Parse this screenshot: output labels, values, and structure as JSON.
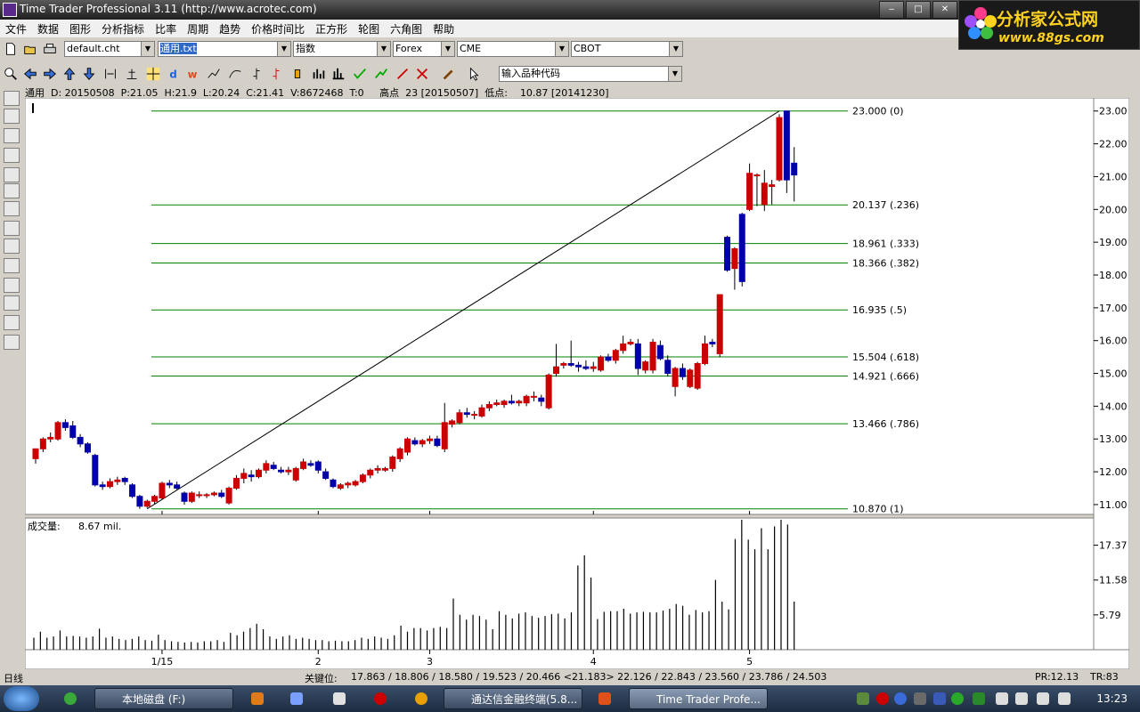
{
  "window": {
    "title": "Time Trader Professional 3.11 (http://www.acrotec.com)"
  },
  "logo": {
    "main": "分析家公式网",
    "url": "www.88gs.com"
  },
  "menu": [
    "文件",
    "数据",
    "图形",
    "分析指标",
    "比率",
    "周期",
    "趋势",
    "价格时间比",
    "正方形",
    "轮图",
    "六角图",
    "帮助"
  ],
  "toolbar": {
    "chart_file": "default.cht",
    "data_file": "通用.txt",
    "index_label": "指数",
    "market1": "Forex",
    "market2": "CME",
    "market3": "CBOT",
    "symbol_input": "输入品种代码"
  },
  "infobar": {
    "text": "通用  D: 20150508  P:21.05  H:21.9  L:20.24  C:21.41  V:8672468  T:0",
    "high_label": "高点",
    "high_text": "23 [20150507]",
    "low_label": "低点:",
    "low_text": "10.87 [20141230]"
  },
  "volume_panel": {
    "label": "成交量:",
    "value": "8.67 mil."
  },
  "statusbar": {
    "period": "日线",
    "key_label": "关键位:",
    "key_values": "17.863 / 18.806 / 18.580 / 19.523 / 20.466 <21.183> 22.126 / 22.843 / 23.560 / 23.786 / 24.503",
    "pr": "PR:12.13",
    "tr": "TR:83"
  },
  "taskbar": {
    "items": [
      "本地磁盘 (F:)",
      "通达信金融终端(5.8...",
      "Time Trader Profe..."
    ],
    "clock": "13:23"
  },
  "colors": {
    "up": "#cc0000",
    "down": "#0000aa",
    "fib": "#008000",
    "bg": "#ffffff"
  },
  "chart_data": [
    {
      "type": "candlestick",
      "x_tick_labels": [
        "1/15",
        "2",
        "3",
        "4",
        "5"
      ],
      "x_tick_index": [
        17,
        38,
        53,
        75,
        96
      ],
      "y_ticks": [
        "11.00",
        "12.00",
        "13.00",
        "14.00",
        "15.00",
        "16.00",
        "17.00",
        "18.00",
        "19.00",
        "20.00",
        "21.00",
        "22.00",
        "23.00"
      ],
      "ylim": [
        10.7,
        23.4
      ],
      "fib_levels": [
        {
          "price": 23.0,
          "label": "23.000",
          "ratio": "(0)"
        },
        {
          "price": 20.137,
          "label": "20.137",
          "ratio": "(.236)"
        },
        {
          "price": 18.961,
          "label": "18.961",
          "ratio": "(.333)"
        },
        {
          "price": 18.366,
          "label": "18.366",
          "ratio": "(.382)"
        },
        {
          "price": 16.935,
          "label": "16.935",
          "ratio": "(.5)"
        },
        {
          "price": 15.504,
          "label": "15.504",
          "ratio": "(.618)"
        },
        {
          "price": 14.921,
          "label": "14.921",
          "ratio": "(.666)"
        },
        {
          "price": 13.466,
          "label": "13.466",
          "ratio": "(.786)"
        },
        {
          "price": 10.87,
          "label": "10.870",
          "ratio": "(1)"
        }
      ],
      "trendline": {
        "from": {
          "index": 15,
          "price": 10.87
        },
        "to": {
          "index": 100,
          "price": 23.0
        }
      },
      "ohlc": [
        [
          12.4,
          12.7,
          12.25,
          12.7
        ],
        [
          12.7,
          13.05,
          12.6,
          13.0
        ],
        [
          13.0,
          13.2,
          12.9,
          13.05
        ],
        [
          13.0,
          13.55,
          12.95,
          13.5
        ],
        [
          13.5,
          13.6,
          13.25,
          13.35
        ],
        [
          13.4,
          13.55,
          13.0,
          13.05
        ],
        [
          13.05,
          13.15,
          12.75,
          12.85
        ],
        [
          12.85,
          12.9,
          12.55,
          12.6
        ],
        [
          12.5,
          12.55,
          11.55,
          11.6
        ],
        [
          11.6,
          11.7,
          11.45,
          11.55
        ],
        [
          11.55,
          11.8,
          11.5,
          11.7
        ],
        [
          11.7,
          11.85,
          11.6,
          11.75
        ],
        [
          11.8,
          11.85,
          11.6,
          11.7
        ],
        [
          11.6,
          11.65,
          11.2,
          11.25
        ],
        [
          11.25,
          11.3,
          10.87,
          10.95
        ],
        [
          10.95,
          11.15,
          10.9,
          11.1
        ],
        [
          11.1,
          11.3,
          11.0,
          11.25
        ],
        [
          11.2,
          11.7,
          11.15,
          11.65
        ],
        [
          11.65,
          11.75,
          11.5,
          11.6
        ],
        [
          11.6,
          11.7,
          11.45,
          11.5
        ],
        [
          11.35,
          11.4,
          11.0,
          11.1
        ],
        [
          11.1,
          11.4,
          11.05,
          11.35
        ],
        [
          11.3,
          11.4,
          11.2,
          11.3
        ],
        [
          11.3,
          11.35,
          11.2,
          11.3
        ],
        [
          11.3,
          11.4,
          11.25,
          11.35
        ],
        [
          11.35,
          11.45,
          11.2,
          11.25
        ],
        [
          11.05,
          11.55,
          11.0,
          11.5
        ],
        [
          11.5,
          11.9,
          11.45,
          11.8
        ],
        [
          11.8,
          12.1,
          11.65,
          11.95
        ],
        [
          11.9,
          12.05,
          11.7,
          11.85
        ],
        [
          11.85,
          12.1,
          11.8,
          12.05
        ],
        [
          12.05,
          12.35,
          11.95,
          12.25
        ],
        [
          12.2,
          12.3,
          12.05,
          12.1
        ],
        [
          12.05,
          12.15,
          11.95,
          12.0
        ],
        [
          12.0,
          12.15,
          11.9,
          12.05
        ],
        [
          11.75,
          12.15,
          11.7,
          12.1
        ],
        [
          12.1,
          12.4,
          12.05,
          12.3
        ],
        [
          12.25,
          12.35,
          12.15,
          12.2
        ],
        [
          12.3,
          12.35,
          11.95,
          12.05
        ],
        [
          12.0,
          12.1,
          11.75,
          11.8
        ],
        [
          11.75,
          11.8,
          11.5,
          11.55
        ],
        [
          11.5,
          11.65,
          11.45,
          11.6
        ],
        [
          11.6,
          11.7,
          11.5,
          11.65
        ],
        [
          11.6,
          11.75,
          11.55,
          11.7
        ],
        [
          11.7,
          11.95,
          11.65,
          11.9
        ],
        [
          11.9,
          12.1,
          11.8,
          12.05
        ],
        [
          12.05,
          12.2,
          11.95,
          12.1
        ],
        [
          12.05,
          12.15,
          12.0,
          12.1
        ],
        [
          12.1,
          12.5,
          12.0,
          12.45
        ],
        [
          12.4,
          12.75,
          12.3,
          12.7
        ],
        [
          12.6,
          13.05,
          12.5,
          13.0
        ],
        [
          12.95,
          13.05,
          12.8,
          12.85
        ],
        [
          12.85,
          13.0,
          12.75,
          12.95
        ],
        [
          12.95,
          13.1,
          12.85,
          13.0
        ],
        [
          13.0,
          13.1,
          12.75,
          12.8
        ],
        [
          12.7,
          14.1,
          12.6,
          13.5
        ],
        [
          13.45,
          13.6,
          13.35,
          13.55
        ],
        [
          13.5,
          13.9,
          13.45,
          13.8
        ],
        [
          13.8,
          13.95,
          13.65,
          13.75
        ],
        [
          13.75,
          13.85,
          13.6,
          13.75
        ],
        [
          13.7,
          14.05,
          13.65,
          13.95
        ],
        [
          13.95,
          14.15,
          13.85,
          14.05
        ],
        [
          14.05,
          14.2,
          14.0,
          14.1
        ],
        [
          14.05,
          14.2,
          13.95,
          14.15
        ],
        [
          14.15,
          14.35,
          14.05,
          14.1
        ],
        [
          14.1,
          14.2,
          14.0,
          14.15
        ],
        [
          14.1,
          14.35,
          14.0,
          14.3
        ],
        [
          14.3,
          14.45,
          14.15,
          14.3
        ],
        [
          14.25,
          14.35,
          14.0,
          14.15
        ],
        [
          13.95,
          15.0,
          13.9,
          14.95
        ],
        [
          15.0,
          15.9,
          14.9,
          15.2
        ],
        [
          15.25,
          15.35,
          15.15,
          15.3
        ],
        [
          15.3,
          16.0,
          15.2,
          15.25
        ],
        [
          15.25,
          15.35,
          15.05,
          15.2
        ],
        [
          15.2,
          15.4,
          15.1,
          15.15
        ],
        [
          15.15,
          15.35,
          15.05,
          15.2
        ],
        [
          15.1,
          15.55,
          15.05,
          15.5
        ],
        [
          15.5,
          15.6,
          15.35,
          15.4
        ],
        [
          15.4,
          15.75,
          15.3,
          15.7
        ],
        [
          15.7,
          16.15,
          15.6,
          15.9
        ],
        [
          15.9,
          16.05,
          15.85,
          15.95
        ],
        [
          15.9,
          16.05,
          14.95,
          15.15
        ],
        [
          15.1,
          15.4,
          15.0,
          15.35
        ],
        [
          15.1,
          16.05,
          15.0,
          15.95
        ],
        [
          15.85,
          16.0,
          15.4,
          15.45
        ],
        [
          15.4,
          15.55,
          14.9,
          15.0
        ],
        [
          14.6,
          15.2,
          14.3,
          15.15
        ],
        [
          15.15,
          15.3,
          14.8,
          14.9
        ],
        [
          14.6,
          15.15,
          14.55,
          15.1
        ],
        [
          14.55,
          15.35,
          14.5,
          15.3
        ],
        [
          15.3,
          16.15,
          15.25,
          15.9
        ],
        [
          15.95,
          16.05,
          15.8,
          15.9
        ],
        [
          15.6,
          17.4,
          15.5,
          17.4
        ],
        [
          19.15,
          19.2,
          18.1,
          18.15
        ],
        [
          18.2,
          18.85,
          17.55,
          18.8
        ],
        [
          19.85,
          19.9,
          17.65,
          17.8
        ],
        [
          20.0,
          21.4,
          19.95,
          21.1
        ],
        [
          21.05,
          21.1,
          20.1,
          21.05
        ],
        [
          20.15,
          21.2,
          19.95,
          20.8
        ],
        [
          20.7,
          20.9,
          20.15,
          20.75
        ],
        [
          20.9,
          22.9,
          20.85,
          22.8
        ],
        [
          23.0,
          23.0,
          20.5,
          20.9
        ],
        [
          21.41,
          21.9,
          20.24,
          21.05
        ]
      ]
    },
    {
      "type": "bar",
      "name": "成交量",
      "y_ticks": [
        "5.79",
        "11.58",
        "17.37"
      ],
      "ylim": [
        0,
        21.9
      ],
      "values": [
        2.0,
        3.0,
        2.0,
        2.2,
        3.2,
        2.2,
        2.3,
        2.2,
        2.0,
        2.2,
        3.5,
        2.0,
        2.2,
        1.8,
        1.6,
        1.8,
        2.2,
        1.6,
        1.5,
        2.5,
        1.6,
        1.4,
        1.3,
        1.2,
        1.3,
        1.2,
        1.4,
        1.4,
        1.6,
        1.3,
        2.8,
        2.4,
        3.0,
        3.6,
        4.3,
        3.4,
        2.2,
        1.8,
        2.2,
        2.4,
        1.8,
        2.0,
        1.8,
        1.6,
        1.6,
        1.4,
        1.5,
        1.4,
        1.4,
        1.6,
        2.0,
        1.8,
        2.2,
        2.0,
        1.8,
        2.4,
        4.0,
        3.0,
        3.6,
        3.6,
        3.2,
        3.6,
        3.8,
        3.6,
        8.5,
        5.8,
        5.0,
        5.8,
        5.6,
        5.0,
        3.4,
        6.4,
        5.8,
        5.2,
        6.0,
        6.2,
        5.6,
        5.3,
        5.6,
        5.9,
        6.0,
        5.2,
        6.2,
        14.0,
        15.7,
        12.0,
        5.1,
        6.3,
        6.4,
        6.4,
        6.8,
        6.0,
        6.2,
        6.3,
        6.2,
        6.2,
        6.5,
        6.8,
        7.6,
        7.3,
        5.8,
        6.6,
        6.2,
        6.4,
        11.6,
        8.0,
        6.7,
        18.4,
        21.6,
        18.3,
        16.7,
        20.2,
        16.7,
        20.5,
        21.6,
        20.8,
        8.0
      ]
    }
  ]
}
